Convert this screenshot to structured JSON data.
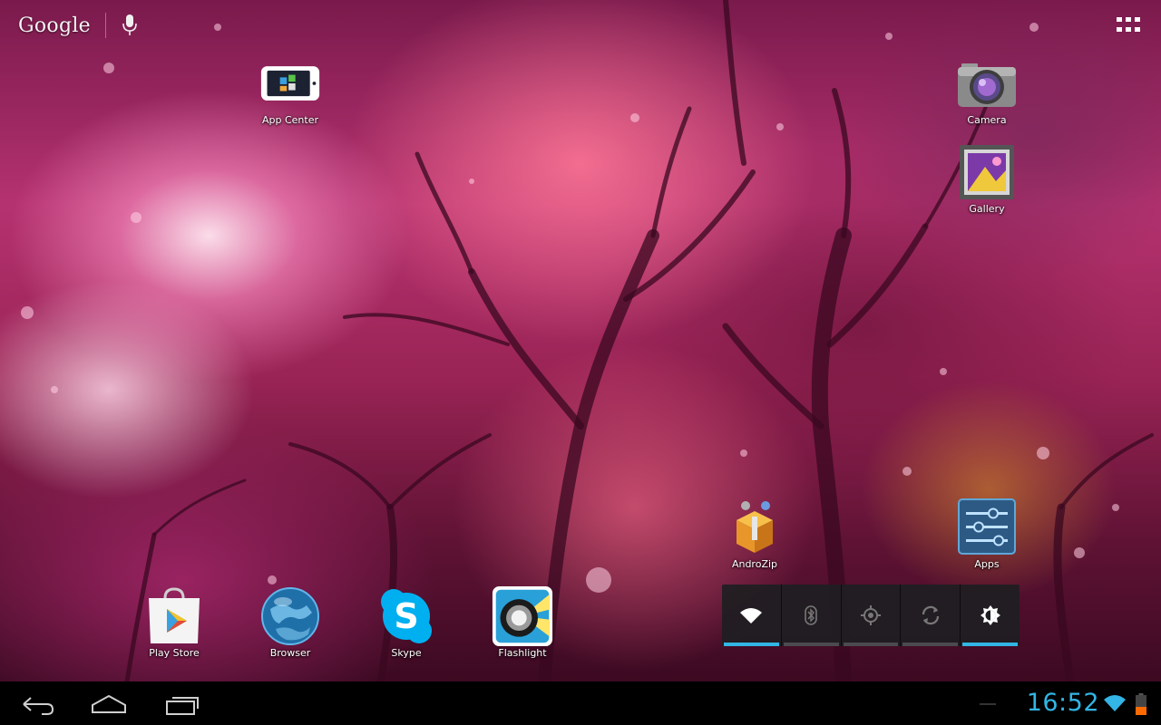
{
  "search": {
    "logo_text": "Google"
  },
  "shortcuts": {
    "app_center": "App Center",
    "camera": "Camera",
    "gallery": "Gallery",
    "androzip": "AndroZip",
    "apps": "Apps",
    "play_store": "Play Store",
    "browser": "Browser",
    "skype": "Skype",
    "flashlight": "Flashlight"
  },
  "power_widget": {
    "toggles": [
      {
        "name": "wifi",
        "on": true
      },
      {
        "name": "bluetooth",
        "on": false
      },
      {
        "name": "gps",
        "on": false
      },
      {
        "name": "sync",
        "on": false
      },
      {
        "name": "brightness",
        "on": true
      }
    ]
  },
  "status_bar": {
    "time": "16:52"
  },
  "colors": {
    "accent": "#33b5e5",
    "wallpaper_pink": "#b53270"
  },
  "icons": [
    "mic-icon",
    "all-apps-icon",
    "back-icon",
    "home-icon",
    "recents-icon",
    "wifi-icon",
    "battery-icon"
  ]
}
